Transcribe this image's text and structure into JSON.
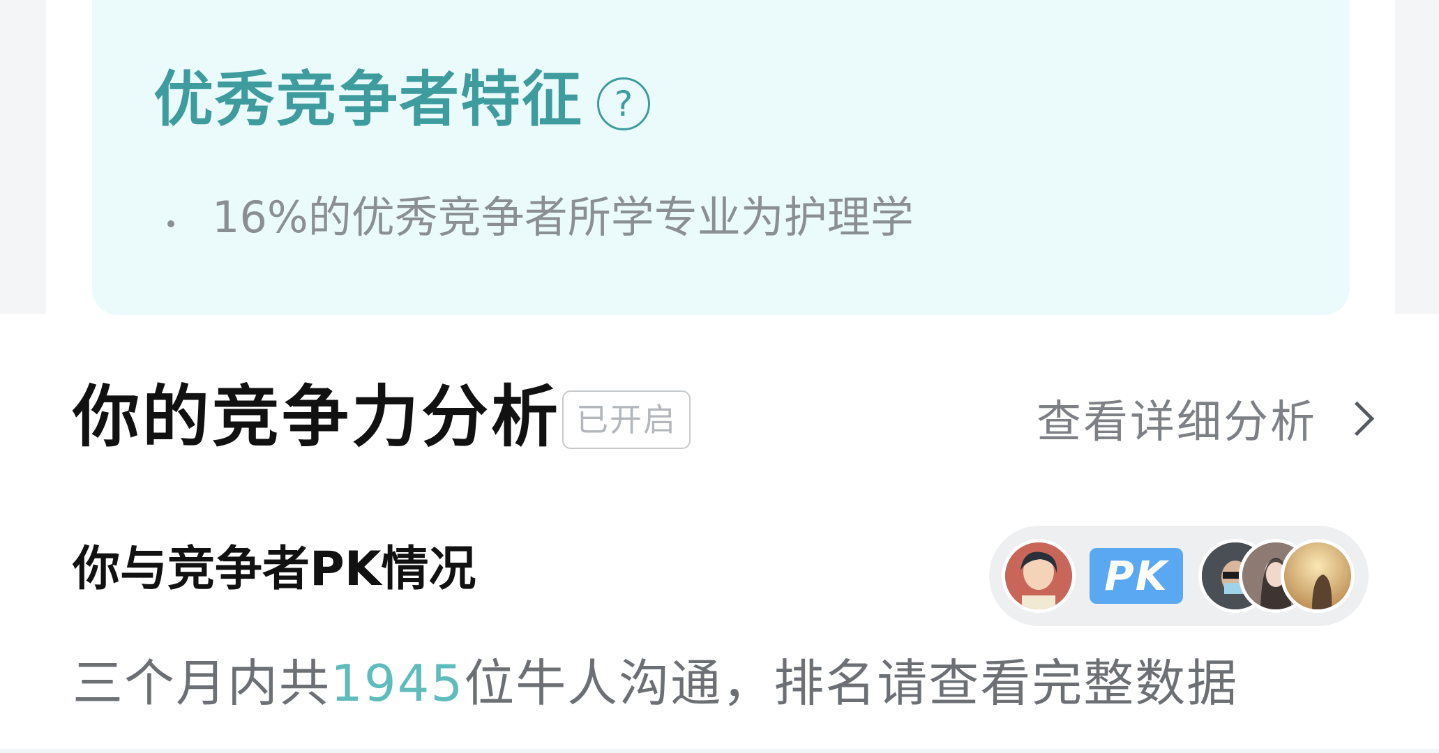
{
  "feature_card": {
    "title": "优秀竞争者特征",
    "help_icon_glyph": "?",
    "items": [
      {
        "text": "16%的优秀竞争者所学专业为护理学"
      }
    ]
  },
  "analysis": {
    "title": "你的竞争力分析",
    "status_badge": "已开启",
    "detail_link_label": "查看详细分析"
  },
  "pk": {
    "title": "你与竞争者PK情况",
    "badge_label": "PK",
    "summary_prefix": "三个月内共",
    "summary_count": "1945",
    "summary_suffix": "位牛人沟通，排名请查看完整数据"
  },
  "colors": {
    "accent_teal": "#3e9c9e",
    "count_teal": "#5fbcbc",
    "card_bg": "#ebfbfb",
    "pk_blue": "#5aa7f2"
  },
  "icons": [
    "help-icon",
    "chevron-right-icon",
    "pk-icon"
  ]
}
